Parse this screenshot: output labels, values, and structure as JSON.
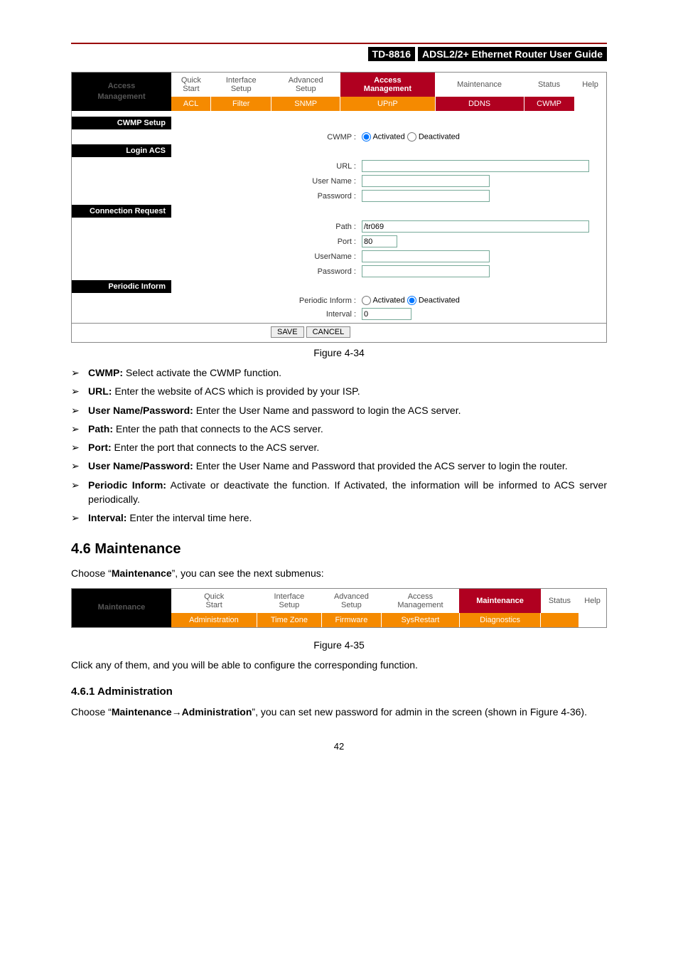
{
  "header": {
    "model": "TD-8816",
    "title": "ADSL2/2+ Ethernet Router User Guide"
  },
  "panel1": {
    "title_l1": "Access",
    "title_l2": "Management",
    "tabs": [
      {
        "l1": "Quick",
        "l2": "Start"
      },
      {
        "l1": "Interface",
        "l2": "Setup"
      },
      {
        "l1": "Advanced",
        "l2": "Setup"
      },
      {
        "l1": "Access",
        "l2": "Management",
        "active": true
      },
      {
        "l1": "Maintenance",
        "l2": ""
      },
      {
        "l1": "Status",
        "l2": ""
      },
      {
        "l1": "Help",
        "l2": ""
      }
    ],
    "subtabs": [
      "ACL",
      "Filter",
      "SNMP",
      "UPnP",
      "DDNS",
      "CWMP"
    ],
    "subtab_active": "CWMP",
    "section1": "CWMP Setup",
    "cwmp_label": "CWMP :",
    "activated": "Activated",
    "deactivated": "Deactivated",
    "section2": "Login ACS",
    "url_label": "URL :",
    "user_label": "User Name :",
    "pass_label": "Password :",
    "section3": "Connection Request",
    "path_label": "Path :",
    "path_value": "/tr069",
    "port_label": "Port :",
    "port_value": "80",
    "user2_label": "UserName :",
    "pass2_label": "Password :",
    "section4": "Periodic Inform",
    "periodic_label": "Periodic Inform :",
    "interval_label": "Interval :",
    "interval_value": "0",
    "save": "SAVE",
    "cancel": "CANCEL"
  },
  "fig1_caption": "Figure 4-34",
  "bullets": [
    {
      "term": "CWMP:",
      "text": " Select activate the CWMP function."
    },
    {
      "term": "URL:",
      "text": " Enter the website of ACS which is provided by your ISP."
    },
    {
      "term": "User Name/Password:",
      "text": " Enter the User Name and password to login the ACS server."
    },
    {
      "term": "Path:",
      "text": " Enter the path that connects to the ACS server."
    },
    {
      "term": "Port:",
      "text": " Enter the port that connects to the ACS server."
    },
    {
      "term": "User Name/Password:",
      "text": " Enter the User Name and Password that provided the ACS server to login the router."
    },
    {
      "term": "Periodic Inform:",
      "text": " Activate or deactivate the function. If Activated, the information will be informed to ACS server periodically."
    },
    {
      "term": "Interval:",
      "text": " Enter the interval time here."
    }
  ],
  "maint_heading": "4.6   Maintenance",
  "maint_intro_pre": "Choose “",
  "maint_intro_bold": "Maintenance",
  "maint_intro_post": "”, you can see the next submenus:",
  "panel2": {
    "title": "Maintenance",
    "tabs": [
      {
        "l1": "Quick",
        "l2": "Start"
      },
      {
        "l1": "Interface",
        "l2": "Setup"
      },
      {
        "l1": "Advanced",
        "l2": "Setup"
      },
      {
        "l1": "Access",
        "l2": "Management"
      },
      {
        "l1": "Maintenance",
        "l2": "",
        "active": true
      },
      {
        "l1": "Status",
        "l2": ""
      },
      {
        "l1": "Help",
        "l2": ""
      }
    ],
    "subtabs": [
      "Administration",
      "Time Zone",
      "Firmware",
      "SysRestart",
      "Diagnostics"
    ]
  },
  "fig2_caption": "Figure 4-35",
  "click_text": "Click any of them, and you will be able to configure the corresponding function.",
  "admin_heading": "4.6.1  Administration",
  "admin_pre": "Choose “",
  "admin_bold1": "Maintenance",
  "admin_arrow": "→",
  "admin_bold2": "Administration",
  "admin_post": "”, you can set new password for admin in the screen (shown in Figure 4-36).",
  "page_number": "42"
}
